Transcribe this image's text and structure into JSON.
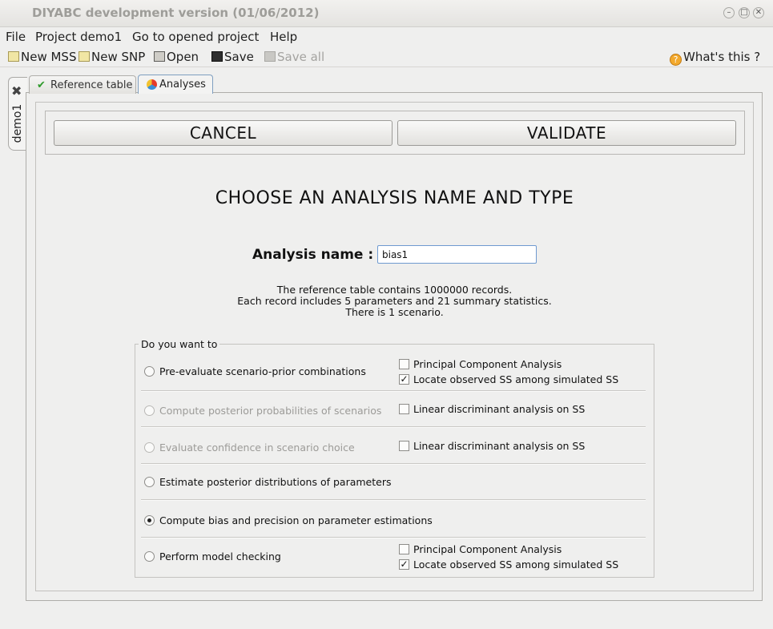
{
  "window": {
    "title": "DIYABC development version  (01/06/2012)"
  },
  "menu": {
    "items": [
      "File",
      "Project demo1",
      "Go to opened project",
      "Help"
    ]
  },
  "toolbar": {
    "new_mss": "New MSS",
    "new_snp": "New SNP",
    "open": "Open",
    "save": "Save",
    "save_all": "Save all",
    "whats_this": "What's this ?"
  },
  "project_tab": {
    "label": "demo1",
    "close_glyph": "✖"
  },
  "tabs": [
    {
      "label": "Reference table",
      "icon": "checkmark-icon"
    },
    {
      "label": "Analyses",
      "icon": "colorwheel-icon"
    }
  ],
  "actions": {
    "cancel": "CANCEL",
    "validate": "VALIDATE"
  },
  "heading": "CHOOSE AN ANALYSIS NAME AND TYPE",
  "analysis_name": {
    "label": "Analysis name :",
    "value": "bias1"
  },
  "info": {
    "line1": "The reference table contains 1000000 records.",
    "line2": "Each record includes 5 parameters and 21 summary statistics.",
    "line3": "There is 1 scenario."
  },
  "options": {
    "legend": "Do you want to",
    "rows": [
      {
        "label": "Pre-evaluate scenario-prior combinations",
        "enabled": true,
        "selected": false,
        "checks": [
          {
            "label": "Principal Component Analysis",
            "checked": false
          },
          {
            "label": "Locate observed SS among simulated SS",
            "checked": true
          }
        ]
      },
      {
        "label": "Compute posterior probabilities of scenarios",
        "enabled": false,
        "selected": false,
        "checks": [
          {
            "label": "Linear discriminant analysis on SS",
            "checked": false
          }
        ]
      },
      {
        "label": "Evaluate confidence in scenario choice",
        "enabled": false,
        "selected": false,
        "checks": [
          {
            "label": "Linear discriminant analysis on SS",
            "checked": false
          }
        ]
      },
      {
        "label": "Estimate posterior distributions of parameters",
        "enabled": true,
        "selected": false,
        "checks": []
      },
      {
        "label": "Compute bias and precision on parameter estimations",
        "enabled": true,
        "selected": true,
        "checks": []
      },
      {
        "label": "Perform model checking",
        "enabled": true,
        "selected": false,
        "checks": [
          {
            "label": "Principal Component Analysis",
            "checked": false
          },
          {
            "label": "Locate observed SS among simulated SS",
            "checked": true
          }
        ]
      }
    ]
  }
}
